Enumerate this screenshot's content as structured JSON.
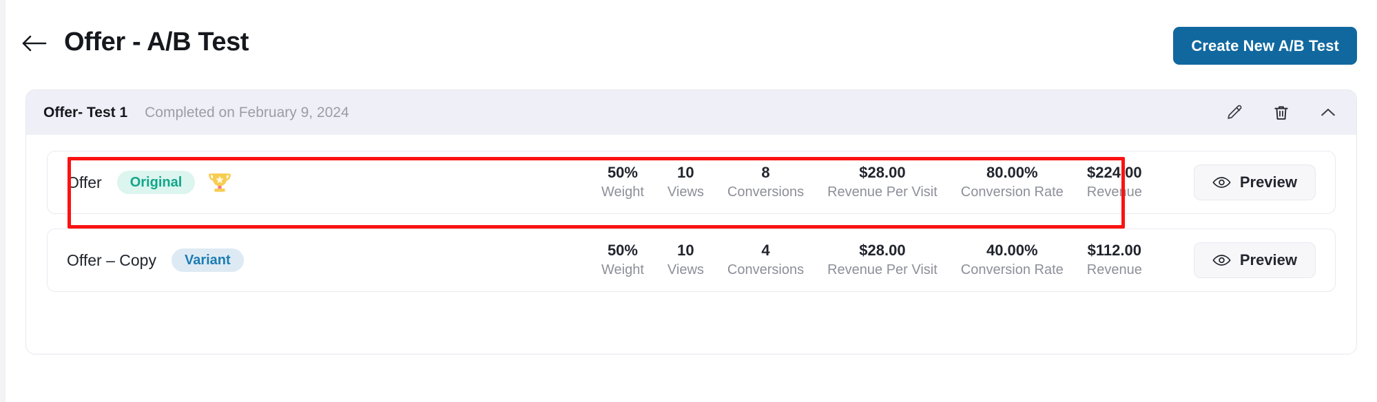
{
  "header": {
    "back_icon": "arrow-left-icon",
    "title": "Offer - A/B Test",
    "create_button_label": "Create New A/B Test",
    "accent_color": "#11689f"
  },
  "test": {
    "name": "Offer- Test 1",
    "status": "Completed on February 9, 2024",
    "actions": [
      {
        "icon": "pencil-icon",
        "name": "edit"
      },
      {
        "icon": "trash-icon",
        "name": "delete"
      },
      {
        "icon": "chevron-up-icon",
        "name": "collapse"
      }
    ],
    "metric_labels": {
      "weight": "Weight",
      "views": "Views",
      "conversions": "Conversions",
      "revenue_per_visit": "Revenue Per Visit",
      "conversion_rate": "Conversion Rate",
      "revenue": "Revenue"
    },
    "preview_label": "Preview",
    "preview_icon": "eye-icon",
    "variants": [
      {
        "label": "Offer",
        "badge": "Original",
        "badge_type": "original",
        "badge_color": "#12a68a",
        "badge_bg": "#dcf5ee",
        "winner": true,
        "winner_icon": "trophy-icon",
        "weight": "50%",
        "views": "10",
        "conversions": "8",
        "revenue_per_visit": "$28.00",
        "conversion_rate": "80.00%",
        "revenue": "$224.00",
        "highlighted": true
      },
      {
        "label": "Offer – Copy",
        "badge": "Variant",
        "badge_type": "variant",
        "badge_color": "#1d7cb2",
        "badge_bg": "#ddeaf4",
        "winner": false,
        "weight": "50%",
        "views": "10",
        "conversions": "4",
        "revenue_per_visit": "$28.00",
        "conversion_rate": "40.00%",
        "revenue": "$112.00",
        "highlighted": false
      }
    ]
  },
  "annotation": {
    "type": "rectangle-highlight",
    "color": "#fb1212",
    "target": "variant-row-original"
  }
}
